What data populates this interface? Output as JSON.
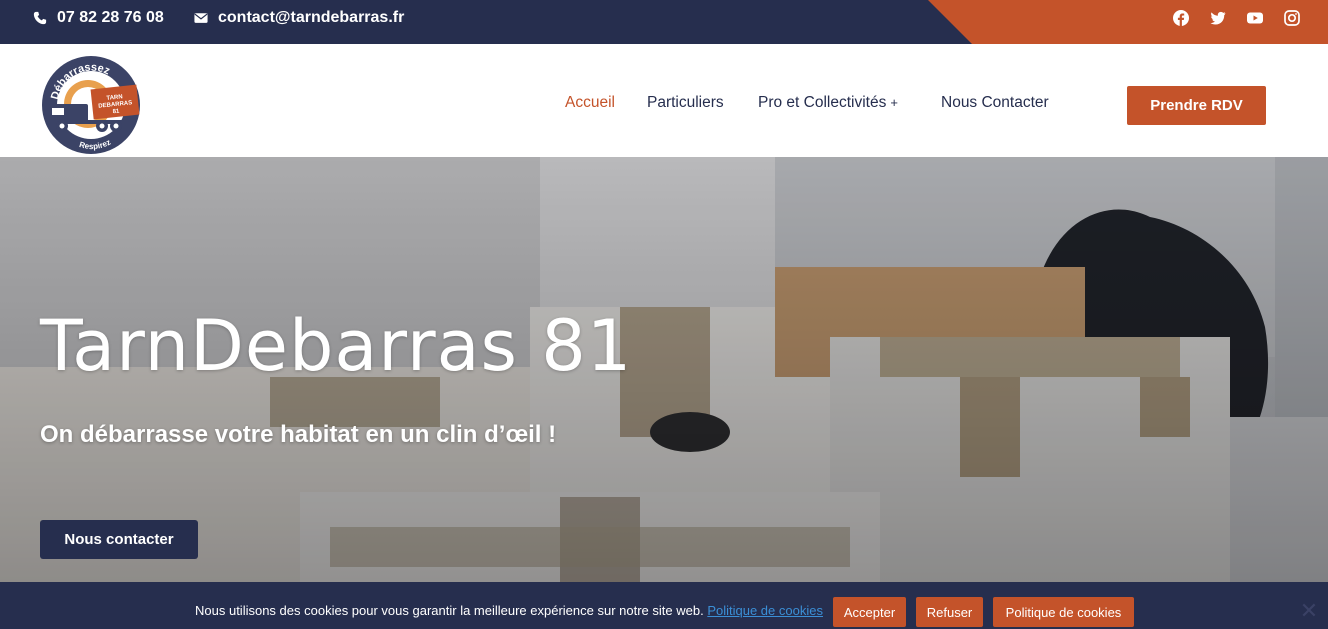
{
  "topbar": {
    "phone": "07 82 28 76 08",
    "email": "contact@tarndebarras.fr",
    "socials": [
      "facebook-icon",
      "twitter-icon",
      "youtube-icon",
      "instagram-icon"
    ]
  },
  "logo": {
    "top_text": "Débarrassez",
    "bottom_text": "Respirez",
    "truck_text_1": "TARN",
    "truck_text_2": "DEBARRAS",
    "truck_text_3": "81"
  },
  "nav": {
    "items": [
      {
        "label": "Accueil",
        "active": true
      },
      {
        "label": "Particuliers"
      },
      {
        "label": "Pro et Collectivités",
        "has_submenu": true,
        "submenu_marker": "+"
      },
      {
        "label": "Nous Contacter"
      }
    ],
    "cta": "Prendre RDV"
  },
  "hero": {
    "title": "TarnDebarras 81",
    "subtitle": "On débarrasse votre habitat en un clin d’œil !",
    "button": "Nous contacter"
  },
  "cookie": {
    "message": "Nous utilisons des cookies pour vous garantir la meilleure expérience sur notre site web.",
    "policy_link": "Politique de cookies",
    "accept": "Accepter",
    "refuse": "Refuser",
    "policy_button": "Politique de cookies",
    "close": "✕"
  },
  "colors": {
    "navy": "#262e4e",
    "orange": "#c4532a",
    "white": "#ffffff"
  }
}
